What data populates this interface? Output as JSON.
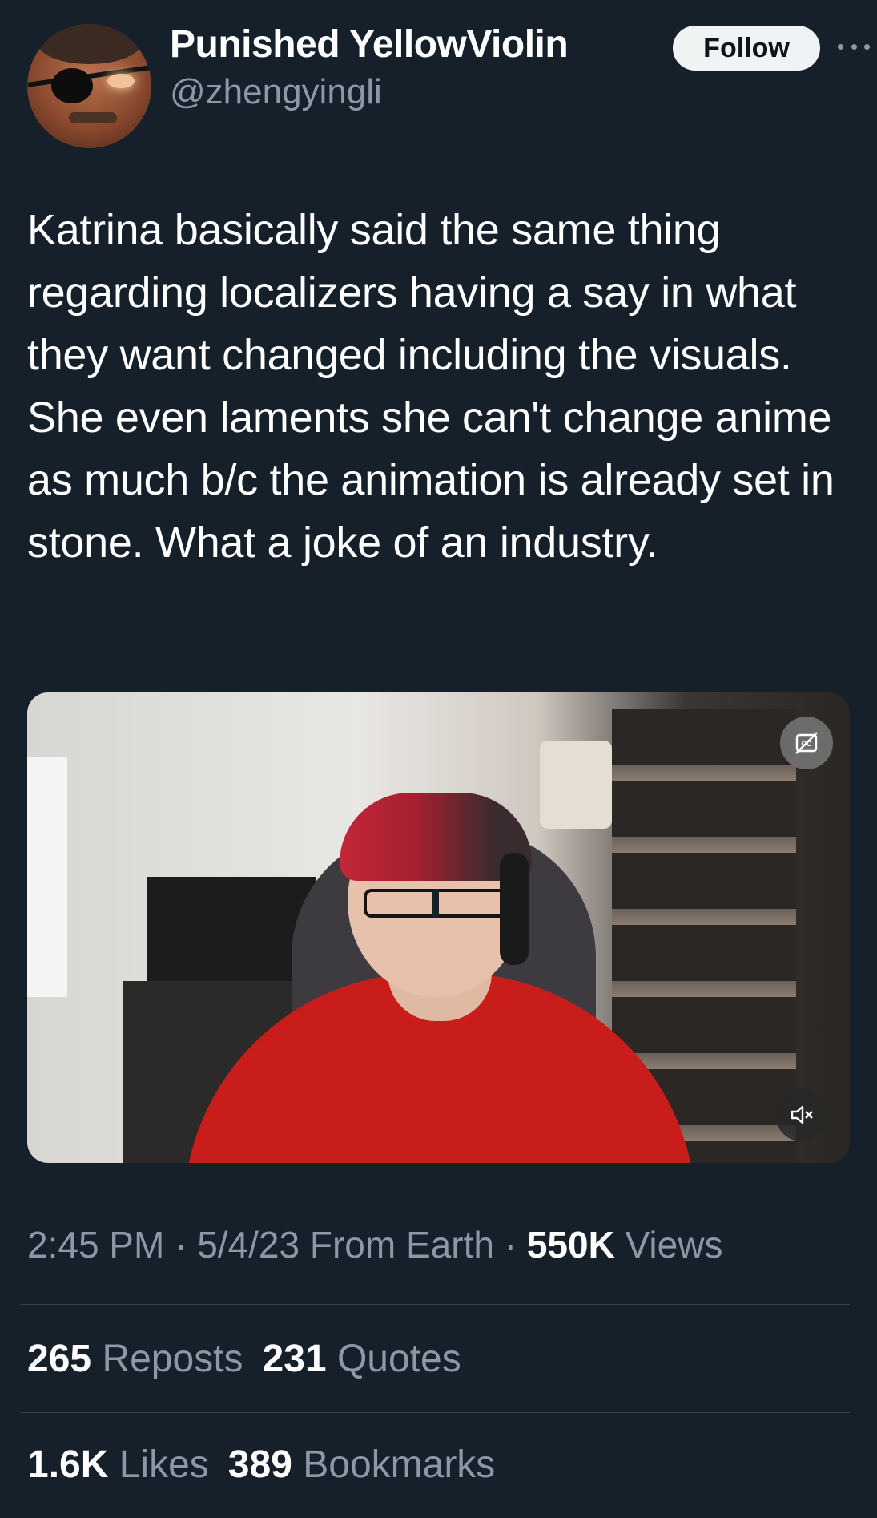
{
  "user": {
    "display_name": "Punished YellowViolin",
    "handle": "@zhengyingli",
    "follow_label": "Follow"
  },
  "tweet": {
    "text": "Katrina basically said the same thing regarding localizers having a say in what they want changed including the visuals. She even laments she can't change anime as much b/c the animation is already set in stone. What a joke of an industry."
  },
  "media": {
    "type": "video",
    "captions_icon": "closed-captions-off-icon",
    "mute_icon": "speaker-muted-icon"
  },
  "meta": {
    "time": "2:45 PM",
    "separator": "·",
    "date": "5/4/23",
    "source": "From Earth",
    "views_count": "550K",
    "views_label": "Views"
  },
  "stats": {
    "reposts_count": "265",
    "reposts_label": "Reposts",
    "quotes_count": "231",
    "quotes_label": "Quotes",
    "likes_count": "1.6K",
    "likes_label": "Likes",
    "bookmarks_count": "389",
    "bookmarks_label": "Bookmarks"
  },
  "colors": {
    "background": "#15202b",
    "secondary_text": "#8b98a5",
    "divider": "#38444d",
    "follow_button_bg": "#eff3f4"
  }
}
